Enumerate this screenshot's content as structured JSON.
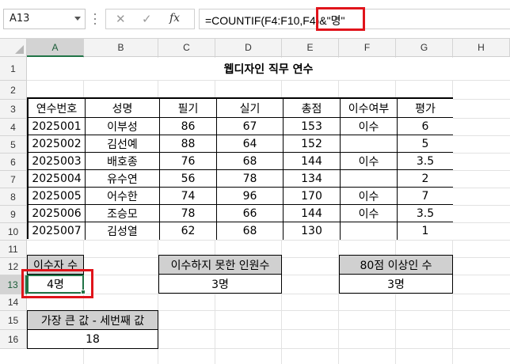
{
  "formula_bar": {
    "name_box": "A13",
    "cancel_icon": "✕",
    "enter_icon": "✓",
    "fx_label": "fx",
    "formula": "=COUNTIF(F4:F10,F4)&\"명\""
  },
  "columns": [
    "A",
    "B",
    "C",
    "D",
    "E",
    "F",
    "G",
    "H"
  ],
  "rows": [
    "1",
    "2",
    "3",
    "4",
    "5",
    "6",
    "7",
    "8",
    "9",
    "10",
    "11",
    "12",
    "13",
    "14",
    "15",
    "16"
  ],
  "sheet": {
    "title": "웹디자인 직무 연수",
    "headers": [
      "연수번호",
      "성명",
      "필기",
      "실기",
      "총점",
      "이수여부",
      "평가"
    ],
    "records": [
      [
        "2025001",
        "이부성",
        "86",
        "67",
        "153",
        "이수",
        "6"
      ],
      [
        "2025002",
        "김선예",
        "88",
        "64",
        "152",
        "",
        "5"
      ],
      [
        "2025003",
        "배호종",
        "76",
        "68",
        "144",
        "이수",
        "3.5"
      ],
      [
        "2025004",
        "유수연",
        "56",
        "78",
        "134",
        "",
        "2"
      ],
      [
        "2025005",
        "어수한",
        "74",
        "96",
        "170",
        "이수",
        "7"
      ],
      [
        "2025006",
        "조승모",
        "78",
        "66",
        "144",
        "이수",
        "3.5"
      ],
      [
        "2025007",
        "김성열",
        "62",
        "68",
        "130",
        "",
        "1"
      ]
    ],
    "summary": {
      "completers_label": "이수자 수",
      "completers_value": "4명",
      "non_completers_label": "이수하지 못한 인원수",
      "non_completers_value": "3명",
      "over80_label": "80점 이상인 수",
      "over80_value": "3명",
      "diff_label": "가장 큰 값 - 세번째 값",
      "diff_value": "18"
    }
  },
  "colors": {
    "selection": "#217346",
    "highlight": "#e0141b",
    "header_fill": "#d0d0d0"
  }
}
